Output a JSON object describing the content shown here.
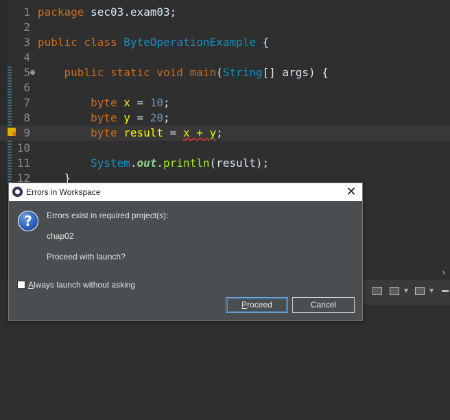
{
  "editor": {
    "lines": [
      {
        "num": "1",
        "parts": [
          {
            "t": "package",
            "c": "kw"
          },
          {
            "t": " sec03.exam03;",
            "c": "plain"
          }
        ]
      },
      {
        "num": "2",
        "parts": []
      },
      {
        "num": "3",
        "parts": [
          {
            "t": "public",
            "c": "kw"
          },
          {
            "t": " ",
            "c": "plain"
          },
          {
            "t": "class",
            "c": "kw"
          },
          {
            "t": " ",
            "c": "plain"
          },
          {
            "t": "ByteOperationExample",
            "c": "cls"
          },
          {
            "t": " {",
            "c": "plain"
          }
        ]
      },
      {
        "num": "4",
        "parts": []
      },
      {
        "num": "5",
        "parts": [
          {
            "t": "    ",
            "c": "plain"
          },
          {
            "t": "public",
            "c": "kw"
          },
          {
            "t": " ",
            "c": "plain"
          },
          {
            "t": "static",
            "c": "kw"
          },
          {
            "t": " ",
            "c": "plain"
          },
          {
            "t": "void",
            "c": "kw"
          },
          {
            "t": " ",
            "c": "plain"
          },
          {
            "t": "main",
            "c": "kw"
          },
          {
            "t": "(",
            "c": "plain"
          },
          {
            "t": "String",
            "c": "cls"
          },
          {
            "t": "[] ",
            "c": "plain"
          },
          {
            "t": "args",
            "c": "plain"
          },
          {
            "t": ") {",
            "c": "plain"
          }
        ]
      },
      {
        "num": "6",
        "parts": []
      },
      {
        "num": "7",
        "parts": [
          {
            "t": "        ",
            "c": "plain"
          },
          {
            "t": "byte",
            "c": "kw"
          },
          {
            "t": " ",
            "c": "plain"
          },
          {
            "t": "x",
            "c": "var"
          },
          {
            "t": " = ",
            "c": "plain"
          },
          {
            "t": "10",
            "c": "num"
          },
          {
            "t": ";",
            "c": "plain"
          }
        ]
      },
      {
        "num": "8",
        "parts": [
          {
            "t": "        ",
            "c": "plain"
          },
          {
            "t": "byte",
            "c": "kw"
          },
          {
            "t": " ",
            "c": "plain"
          },
          {
            "t": "y",
            "c": "var"
          },
          {
            "t": " = ",
            "c": "plain"
          },
          {
            "t": "20",
            "c": "num"
          },
          {
            "t": ";",
            "c": "plain"
          }
        ]
      },
      {
        "num": "9",
        "parts": [
          {
            "t": "        ",
            "c": "plain"
          },
          {
            "t": "byte",
            "c": "kw"
          },
          {
            "t": " ",
            "c": "plain"
          },
          {
            "t": "result",
            "c": "var"
          },
          {
            "t": " = ",
            "c": "plain"
          },
          {
            "t": "x + y",
            "c": "var err-underline"
          },
          {
            "t": ";",
            "c": "plain"
          }
        ],
        "current": true
      },
      {
        "num": "10",
        "parts": []
      },
      {
        "num": "11",
        "parts": [
          {
            "t": "        ",
            "c": "plain"
          },
          {
            "t": "System",
            "c": "cls"
          },
          {
            "t": ".",
            "c": "plain"
          },
          {
            "t": "out",
            "c": "field"
          },
          {
            "t": ".",
            "c": "plain"
          },
          {
            "t": "println",
            "c": "meth"
          },
          {
            "t": "(result);",
            "c": "plain"
          }
        ]
      },
      {
        "num": "12",
        "parts": [
          {
            "t": "    }",
            "c": "plain"
          }
        ]
      }
    ]
  },
  "dialog": {
    "title": "Errors in Workspace",
    "message": "Errors exist in required project(s):",
    "project": "chap02",
    "question": "Proceed with launch?",
    "checkbox_accel": "A",
    "checkbox_rest": "lways launch without asking",
    "checkbox_checked": false,
    "proceed_accel": "P",
    "proceed_rest": "roceed",
    "cancel_label": "Cancel",
    "close_glyph": "✕"
  }
}
